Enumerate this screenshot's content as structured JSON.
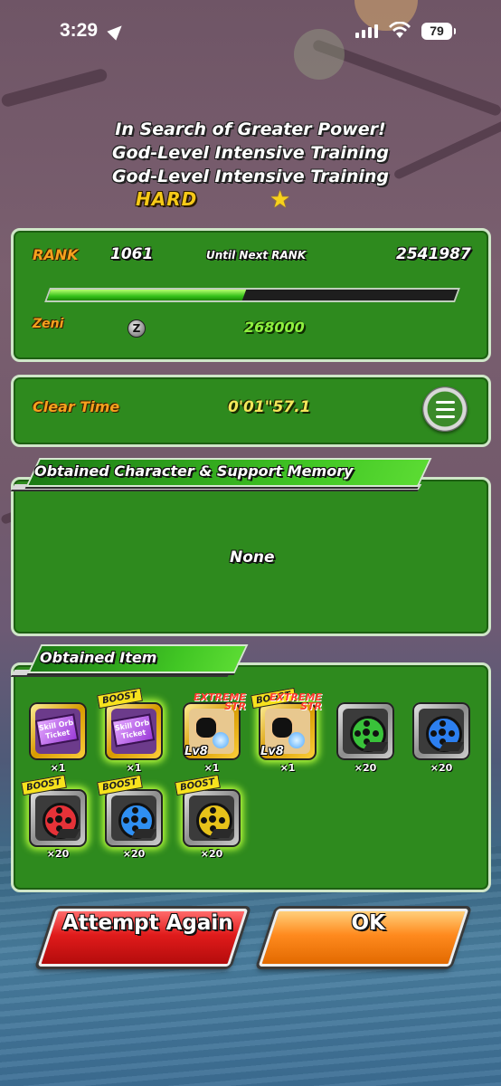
{
  "status_bar": {
    "time": "3:29",
    "battery": "79"
  },
  "stage": {
    "title_lines": [
      "In Search of Greater Power!",
      "God-Level Intensive Training",
      "God-Level Intensive Training"
    ],
    "difficulty": "HARD",
    "star_icon": "★"
  },
  "rank_panel": {
    "rank_label": "RANK",
    "rank_value": "1061",
    "until_next_label": "Until Next RANK",
    "until_next_value": "2541987",
    "progress_fraction": 0.48,
    "zeni_label": "Zeni",
    "zeni_icon": "Z",
    "zeni_value": "268000"
  },
  "clear_panel": {
    "label": "Clear Time",
    "value": "0'01\"57.1"
  },
  "character_section": {
    "header": "Obtained Character & Support Memory",
    "empty_text": "None"
  },
  "item_section": {
    "header": "Obtained Item",
    "items": [
      {
        "type": "skill-orb-ticket",
        "label": "Skill Orb Ticket",
        "qty": "×1",
        "boost": false
      },
      {
        "type": "skill-orb-ticket",
        "label": "Skill Orb Ticket",
        "qty": "×1",
        "boost": true,
        "boost_label": "BOOST"
      },
      {
        "type": "str-training-item",
        "lv": "Lv8",
        "extreme": "EXTREME STR",
        "qty": "×1",
        "boost": false
      },
      {
        "type": "str-training-item",
        "lv": "Lv8",
        "extreme": "EXTREME STR",
        "qty": "×1",
        "boost": true,
        "boost_label": "BOOST"
      },
      {
        "type": "film-reel",
        "color": "#39c23a",
        "qty": "×20",
        "boost": false
      },
      {
        "type": "film-reel",
        "color": "#2c7ff0",
        "qty": "×20",
        "boost": false
      },
      {
        "type": "film-reel",
        "color": "#e53238",
        "qty": "×20",
        "boost": true,
        "boost_label": "BOOST"
      },
      {
        "type": "film-reel",
        "color": "#2f8ff2",
        "qty": "×20",
        "boost": true,
        "boost_label": "BOOST"
      },
      {
        "type": "film-reel",
        "color": "#e6c21a",
        "qty": "×20",
        "boost": true,
        "boost_label": "BOOST"
      }
    ]
  },
  "buttons": {
    "attempt_again": "Attempt Again",
    "ok": "OK"
  }
}
